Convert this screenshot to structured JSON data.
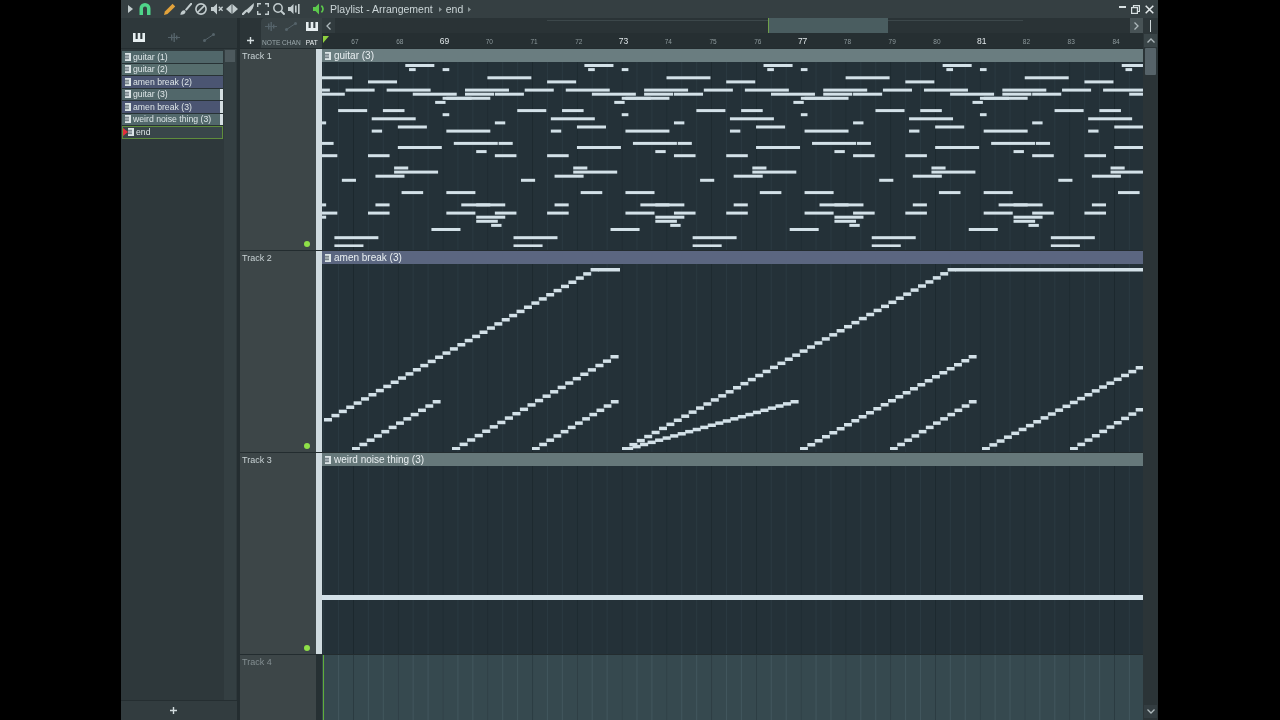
{
  "title_bar": {
    "tools": [
      {
        "kind": "menu",
        "selected": false
      },
      {
        "kind": "magnet",
        "selected": true
      },
      {
        "kind": "pencil",
        "selected": true
      },
      {
        "kind": "brush",
        "selected": false
      },
      {
        "kind": "delete",
        "selected": false
      },
      {
        "kind": "mute",
        "selected": false
      },
      {
        "kind": "slip",
        "selected": false
      },
      {
        "kind": "slice",
        "selected": false
      },
      {
        "kind": "select",
        "selected": false
      },
      {
        "kind": "zoom",
        "selected": false
      },
      {
        "kind": "playback",
        "selected": false
      }
    ],
    "title": "Playlist - Arrangement",
    "pattern": "end"
  },
  "picker": {
    "tabs": [
      {
        "kind": "piano",
        "selected": true
      },
      {
        "kind": "waveform",
        "selected": false
      },
      {
        "kind": "curve",
        "selected": false
      }
    ],
    "patterns": [
      {
        "label": "guitar (1)",
        "color": "#51676a",
        "selected": false,
        "playing": false
      },
      {
        "label": "guitar (2)",
        "color": "#566d6d",
        "selected": false,
        "playing": false
      },
      {
        "label": "amen break (2)",
        "color": "#4b5572",
        "selected": false,
        "playing": false
      },
      {
        "label": "guitar (3)",
        "color": "#51676a",
        "selected": false,
        "playing": true
      },
      {
        "label": "amen break (3)",
        "color": "#4b5572",
        "selected": false,
        "playing": true
      },
      {
        "label": "weird noise thing (3)",
        "color": "#52686b",
        "selected": false,
        "playing": true
      },
      {
        "label": "end",
        "color": "#39464a",
        "selected": true,
        "playing": false
      }
    ]
  },
  "modes": [
    {
      "kind": "waveform",
      "label": "NOTE",
      "selected": false
    },
    {
      "kind": "curve",
      "label": "CHAN",
      "selected": false
    },
    {
      "kind": "piano",
      "label": "PAT",
      "selected": true
    }
  ],
  "ruler": {
    "bars": [
      {
        "label": "67",
        "major": false
      },
      {
        "label": "68",
        "major": false
      },
      {
        "label": "69",
        "major": true
      },
      {
        "label": "70",
        "major": false
      },
      {
        "label": "71",
        "major": false
      },
      {
        "label": "72",
        "major": false
      },
      {
        "label": "73",
        "major": true
      },
      {
        "label": "74",
        "major": false
      },
      {
        "label": "75",
        "major": false
      },
      {
        "label": "76",
        "major": false
      },
      {
        "label": "77",
        "major": true
      },
      {
        "label": "78",
        "major": false
      },
      {
        "label": "79",
        "major": false
      },
      {
        "label": "80",
        "major": false
      },
      {
        "label": "81",
        "major": true
      },
      {
        "label": "82",
        "major": false
      },
      {
        "label": "83",
        "major": false
      },
      {
        "label": "84",
        "major": false
      }
    ]
  },
  "tracks": [
    {
      "name": "Track 1",
      "muted": false,
      "playing": true,
      "clip": {
        "label": "guitar (3)",
        "kind": "melody",
        "color": "#6a7d80"
      }
    },
    {
      "name": "Track 2",
      "muted": false,
      "playing": true,
      "clip": {
        "label": "amen break (3)",
        "kind": "slices",
        "color": "#5b6680"
      }
    },
    {
      "name": "Track 3",
      "muted": false,
      "playing": true,
      "clip": {
        "label": "weird noise thing (3)",
        "kind": "sustain",
        "color": "#66787a"
      }
    },
    {
      "name": "Track 4",
      "playing": false
    }
  ]
}
